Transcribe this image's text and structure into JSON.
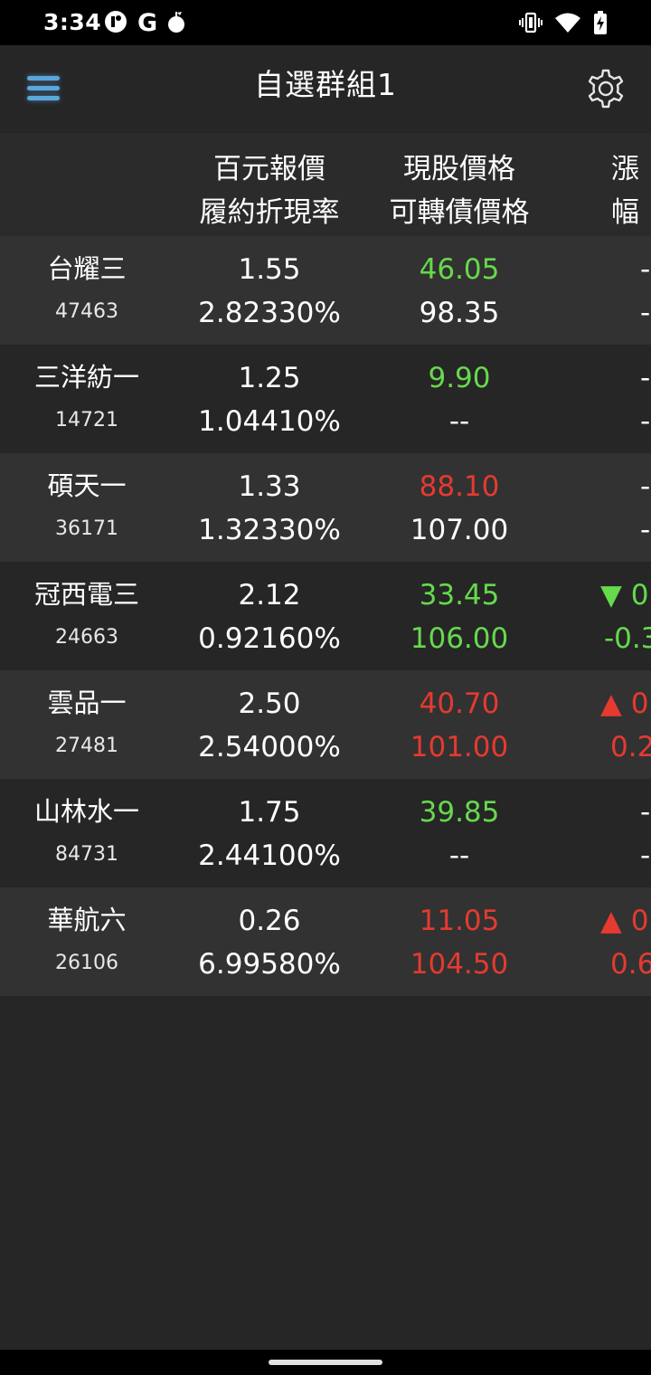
{
  "status_bar": {
    "time": "3:34",
    "left_icons": [
      "app-notification-icon",
      "google-icon",
      "alert-drop-icon"
    ],
    "google_glyph": "G",
    "right_icons": [
      "vibrate-icon",
      "wifi-icon",
      "battery-charging-icon"
    ]
  },
  "app_bar": {
    "title": "自選群組1",
    "menu_icon": "menu-icon",
    "settings_icon": "gear-icon",
    "accent": "#5aa7dc"
  },
  "header": {
    "col1_line1": "百元報價",
    "col1_line2": "履約折現率",
    "col2_line1": "現股價格",
    "col2_line2": "可轉債價格",
    "col3_line1": "漲",
    "col3_line2": "幅"
  },
  "colors": {
    "up": "#e53a30",
    "down": "#66d94d",
    "neutral": "#ffffff"
  },
  "rows": [
    {
      "name": "台耀三",
      "code": "47463",
      "quote": "1.55",
      "rate": "2.82330%",
      "stock_price": "46.05",
      "stock_color": "green",
      "cb_price": "98.35",
      "cb_color": "white",
      "change_line1": "-",
      "change_line2": "-",
      "change_color": "white"
    },
    {
      "name": "三洋紡一",
      "code": "14721",
      "quote": "1.25",
      "rate": "1.04410%",
      "stock_price": "9.90",
      "stock_color": "green",
      "cb_price": "--",
      "cb_color": "white",
      "change_line1": "-",
      "change_line2": "-",
      "change_color": "white"
    },
    {
      "name": "碩天一",
      "code": "36171",
      "quote": "1.33",
      "rate": "1.32330%",
      "stock_price": "88.10",
      "stock_color": "red",
      "cb_price": "107.00",
      "cb_color": "white",
      "change_line1": "-",
      "change_line2": "-",
      "change_color": "white"
    },
    {
      "name": "冠西電三",
      "code": "24663",
      "quote": "2.12",
      "rate": "0.92160%",
      "stock_price": "33.45",
      "stock_color": "green",
      "cb_price": "106.00",
      "cb_color": "green",
      "change_line1": "▼ 0",
      "change_line2": "-0.3",
      "change_color": "green"
    },
    {
      "name": "雲品一",
      "code": "27481",
      "quote": "2.50",
      "rate": "2.54000%",
      "stock_price": "40.70",
      "stock_color": "red",
      "cb_price": "101.00",
      "cb_color": "red",
      "change_line1": "▲ 0",
      "change_line2": "0.2",
      "change_color": "red"
    },
    {
      "name": "山林水一",
      "code": "84731",
      "quote": "1.75",
      "rate": "2.44100%",
      "stock_price": "39.85",
      "stock_color": "green",
      "cb_price": "--",
      "cb_color": "white",
      "change_line1": "-",
      "change_line2": "-",
      "change_color": "white"
    },
    {
      "name": "華航六",
      "code": "26106",
      "quote": "0.26",
      "rate": "6.99580%",
      "stock_price": "11.05",
      "stock_color": "red",
      "cb_price": "104.50",
      "cb_color": "red",
      "change_line1": "▲ 0",
      "change_line2": "0.6",
      "change_color": "red"
    }
  ]
}
